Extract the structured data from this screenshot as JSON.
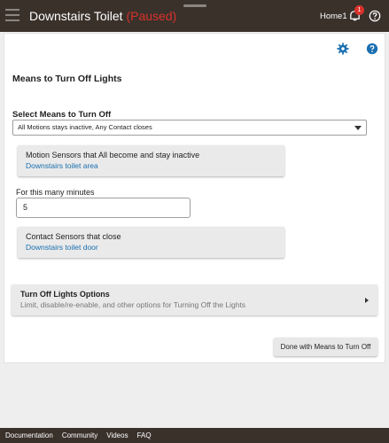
{
  "header": {
    "title": "Downstairs Toilet",
    "status": "(Paused)",
    "hub_name": "Home1",
    "notification_count": "1",
    "colors": {
      "bar": "#3a312b",
      "paused": "#d9322b",
      "badge": "#d9322b"
    }
  },
  "page": {
    "section_title": "Means to Turn Off Lights",
    "select_label": "Select Means to Turn Off",
    "select_value": "All Motions stays inactive, Any Contact closes",
    "motion": {
      "title": "Motion Sensors that All become and stay inactive",
      "value": "Downstairs toilet area"
    },
    "minutes": {
      "label": "For this many minutes",
      "value": "5"
    },
    "contact": {
      "title": "Contact Sensors that close",
      "value": "Downstairs toilet door"
    },
    "options": {
      "title": "Turn Off Lights Options",
      "subtitle": "Limit, disable/re-enable, and other options for Turning Off the Lights"
    },
    "done_label": "Done with Means to Turn Off",
    "accent_color": "#1a6fb0"
  },
  "icons": {
    "menu": "menu-icon",
    "notifications": "bell-icon",
    "help_top": "help-icon",
    "settings": "gear-icon",
    "help": "help-icon",
    "select_caret": "caret-down-icon",
    "options_arrow": "chevron-right-icon"
  },
  "footer": {
    "links": [
      "Documentation",
      "Community",
      "Videos",
      "FAQ"
    ]
  }
}
